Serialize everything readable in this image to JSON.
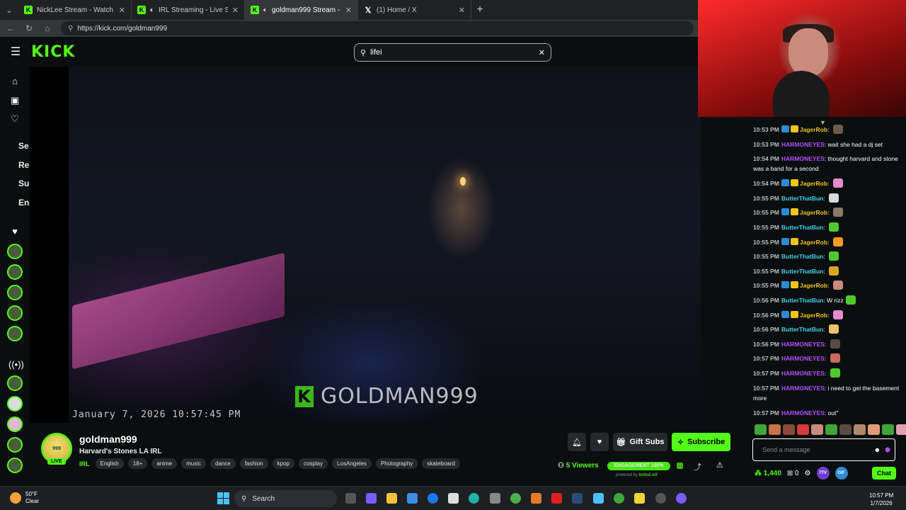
{
  "browser": {
    "tabs": [
      {
        "title": "NickLee Stream - Watch Live o",
        "icon": "kick-favicon",
        "active": false
      },
      {
        "title": "IRL Streaming - Live Streams o",
        "icon": "kick-favicon",
        "active": false
      },
      {
        "title": "goldman999 Stream - Watch Li",
        "icon": "kick-favicon",
        "active": true
      },
      {
        "title": "(1) Home / X",
        "icon": "x-favicon",
        "active": false
      }
    ],
    "url": "https://kick.com/goldman999"
  },
  "kick": {
    "logo": "KICK",
    "search_value": "lifei",
    "sidebar_texts": [
      "Se",
      "Re",
      "Su",
      "En"
    ]
  },
  "video": {
    "watermark": "GOLDMAN999",
    "watermark_logo": "K",
    "timestamp": "January 7, 2026 10:57:45 PM"
  },
  "stream": {
    "avatar_text": "999",
    "live_label": "LIVE",
    "streamer": "goldman999",
    "title": "Harvard's Stones LA IRL",
    "category": "IRL",
    "tags": [
      "English",
      "18+",
      "anime",
      "music",
      "dance",
      "fashion",
      "kpop",
      "cosplay",
      "LosAngeles",
      "Photography",
      "skateboard"
    ],
    "gift_label": "Gift Subs",
    "subscribe_label": "Subscribe",
    "viewers_count": "5",
    "viewers_label": "Viewers",
    "engagement_label": "ENGAGEMENT 100%",
    "powered_by_prefix": "powered by",
    "powered_by_brand": "botted.wtf"
  },
  "chat": {
    "messages": [
      {
        "time": "10:53 PM",
        "user": "JagerRob",
        "color": "#f0c419",
        "text": "",
        "badges": true,
        "emote": "#6b5a4a"
      },
      {
        "time": "10:53 PM",
        "user": "HARMONEYES",
        "color": "#b44dff",
        "text": "wait she had a dj set",
        "badges": false,
        "emote": ""
      },
      {
        "time": "10:54 PM",
        "user": "HARMONEYES",
        "color": "#b44dff",
        "text": "thought harvard and stone was a band for a second",
        "badges": false,
        "emote": ""
      },
      {
        "time": "10:54 PM",
        "user": "JagerRob",
        "color": "#f0c419",
        "text": "",
        "badges": true,
        "emote": "#e58ad1"
      },
      {
        "time": "10:55 PM",
        "user": "ButterThatBun",
        "color": "#3fd1e8",
        "text": "",
        "badges": false,
        "emote": "#d9d9d9"
      },
      {
        "time": "10:55 PM",
        "user": "JagerRob",
        "color": "#f0c419",
        "text": "",
        "badges": true,
        "emote": "#8a7a6a"
      },
      {
        "time": "10:55 PM",
        "user": "ButterThatBun",
        "color": "#3fd1e8",
        "text": "",
        "badges": false,
        "emote": "#4fc92f"
      },
      {
        "time": "10:55 PM",
        "user": "JagerRob",
        "color": "#f0c419",
        "text": "",
        "badges": true,
        "emote": "#f59a23"
      },
      {
        "time": "10:55 PM",
        "user": "ButterThatBun",
        "color": "#3fd1e8",
        "text": "",
        "badges": false,
        "emote": "#4fc92f"
      },
      {
        "time": "10:55 PM",
        "user": "ButterThatBun",
        "color": "#3fd1e8",
        "text": "",
        "badges": false,
        "emote": "#d9a520"
      },
      {
        "time": "10:55 PM",
        "user": "JagerRob",
        "color": "#f0c419",
        "text": "",
        "badges": true,
        "emote": "#c98b7c"
      },
      {
        "time": "10:56 PM",
        "user": "ButterThatBun",
        "color": "#3fd1e8",
        "text": "W rizz",
        "badges": false,
        "emote": "#4fc92f"
      },
      {
        "time": "10:56 PM",
        "user": "JagerRob",
        "color": "#f0c419",
        "text": "",
        "badges": true,
        "emote": "#e58ad1"
      },
      {
        "time": "10:56 PM",
        "user": "ButterThatBun",
        "color": "#3fd1e8",
        "text": "",
        "badges": false,
        "emote": "#e8c46a"
      },
      {
        "time": "10:56 PM",
        "user": "HARMONEYES",
        "color": "#b44dff",
        "text": "",
        "badges": false,
        "emote": "#5a4a44"
      },
      {
        "time": "10:57 PM",
        "user": "HARMONEYES",
        "color": "#b44dff",
        "text": "",
        "badges": false,
        "emote": "#c96a5a"
      },
      {
        "time": "10:57 PM",
        "user": "HARMONEYES",
        "color": "#b44dff",
        "text": "",
        "badges": false,
        "emote": "#4fc92f"
      },
      {
        "time": "10:57 PM",
        "user": "HARMONEYES",
        "color": "#b44dff",
        "text": "i need to get the basement more",
        "badges": false,
        "emote": ""
      },
      {
        "time": "10:57 PM",
        "user": "HARMONEYES",
        "color": "#b44dff",
        "text": "out\"",
        "badges": false,
        "emote": ""
      }
    ],
    "emote_bar_colors": [
      "#3fa63a",
      "#c9714a",
      "#8a4a3a",
      "#d63a3a",
      "#c98b7c",
      "#3fa63a",
      "#5a4a44",
      "#b08a6a",
      "#e09a7a",
      "#3fa63a",
      "#e0a0b0"
    ],
    "input_placeholder": "Send a message",
    "points": "1,440",
    "gifts": "0",
    "chat_button": "Chat",
    "ext1": "7TV",
    "ext2": "GIF"
  },
  "taskbar": {
    "temp": "50°F",
    "weather": "Clear",
    "search": "Search",
    "time": "10:57 PM",
    "date": "1/7/2026"
  },
  "colors": {
    "kick_green": "#53fc18",
    "bg": "#0b0e0f"
  }
}
